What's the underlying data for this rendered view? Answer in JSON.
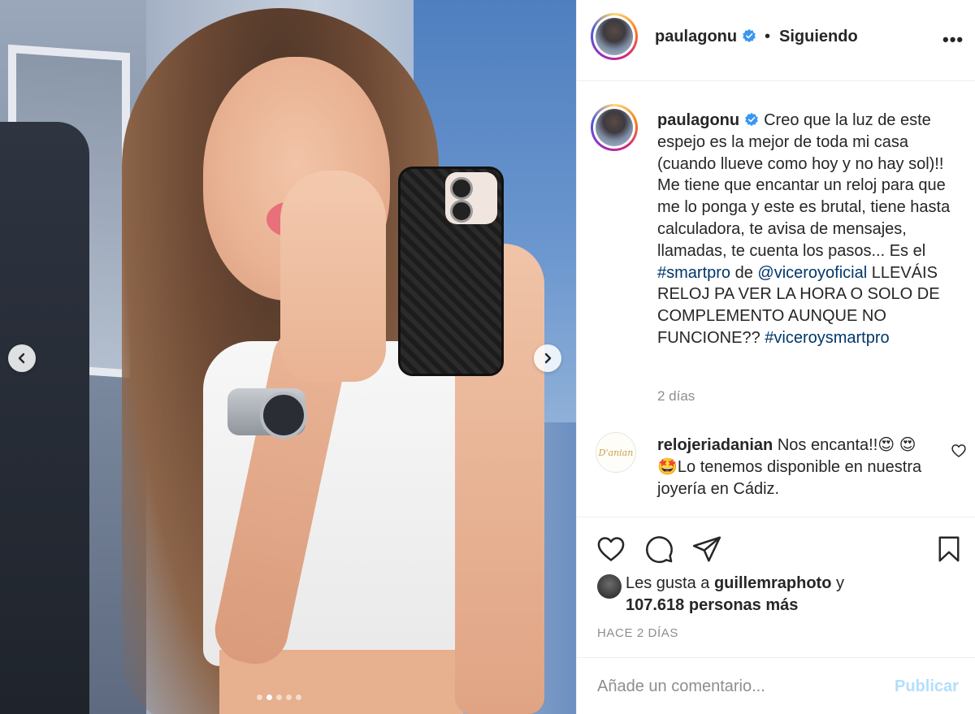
{
  "post": {
    "carousel": {
      "slide_count": 5,
      "active_index": 1,
      "prev_icon": "chevron-left-icon",
      "next_icon": "chevron-right-icon"
    }
  },
  "header": {
    "username": "paulagonu",
    "separator": "•",
    "follow_status": "Siguiendo",
    "more_icon": "more-horizontal-icon",
    "more_glyph": "•••"
  },
  "caption": {
    "username": "paulagonu",
    "text_1": "Creo que la luz de este espejo es la mejor de toda mi casa (cuando llueve como hoy y no hay sol)!! Me tiene que encantar un reloj para que me lo ponga y este es brutal, tiene hasta calculadora, te avisa de mensajes, llamadas, te cuenta los pasos... Es el ",
    "hashtag_1": "#smartpro",
    "text_2": " de ",
    "mention": "@viceroyoficial",
    "text_3": " LLEVÁIS RELOJ PA VER LA HORA O SOLO DE COMPLEMENTO AUNQUE NO FUNCIONE?? ",
    "hashtag_2": "#viceroysmartpro",
    "time": "2 días"
  },
  "comment": {
    "username": "relojeriadanian",
    "avatar_text": "D'anian",
    "text": "Nos encanta!!😍 😍🤩Lo tenemos disponible en nuestra joyería en Cádiz.",
    "like_icon": "heart-outline-icon"
  },
  "actions": {
    "like_icon": "heart-outline-icon",
    "comment_icon": "comment-bubble-icon",
    "share_icon": "paper-plane-icon",
    "save_icon": "bookmark-icon"
  },
  "likes": {
    "prefix": "Les gusta a ",
    "liker": "guillemraphoto",
    "conjunction": " y",
    "others": "107.618 personas más"
  },
  "posted_ago": "HACE 2 DÍAS",
  "add_comment": {
    "placeholder": "Añade un comentario...",
    "submit_label": "Publicar"
  },
  "colors": {
    "link": "#00376b",
    "verified": "#3897f0",
    "muted": "#8e8e8e",
    "publish_disabled": "#b2dffc"
  }
}
